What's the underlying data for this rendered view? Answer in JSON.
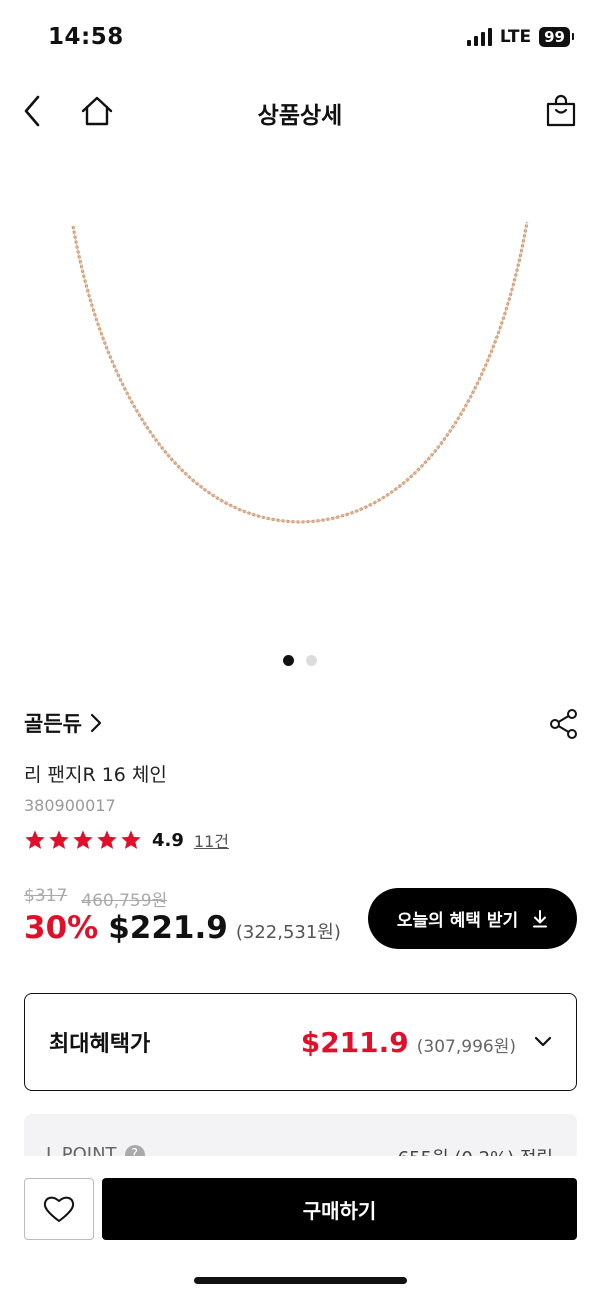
{
  "status_bar": {
    "time": "14:58",
    "network": "LTE",
    "battery": "99"
  },
  "nav": {
    "title": "상품상세",
    "back_icon": "chevron-left-icon",
    "home_icon": "home-icon",
    "bag_icon": "shopping-bag-icon"
  },
  "product": {
    "image_pages": 2,
    "active_image": 1,
    "brand": "골든듀",
    "name": "리 팬지R 16 체인",
    "code": "380900017",
    "rating": "4.9",
    "stars": 5,
    "review_count": "11건",
    "original_usd": "$317",
    "original_krw": "460,759원",
    "discount": "30%",
    "sale_usd": "$221.9",
    "sale_krw": "(322,531원)"
  },
  "benefit_button": {
    "label": "오늘의 혜택 받기",
    "icon": "download-icon"
  },
  "max_benefit": {
    "label": "최대혜택가",
    "price_usd": "$211.9",
    "price_krw": "(307,996원)",
    "icon": "chevron-down-icon"
  },
  "points": {
    "label": "L.POINT",
    "value": "655원 (0.2%) 적립"
  },
  "bottom": {
    "buy_label": "구매하기",
    "wish_icon": "heart-icon"
  },
  "colors": {
    "accent_red": "#e0102b",
    "star_red": "#e0102b",
    "chain_gold": "#c9956f"
  }
}
